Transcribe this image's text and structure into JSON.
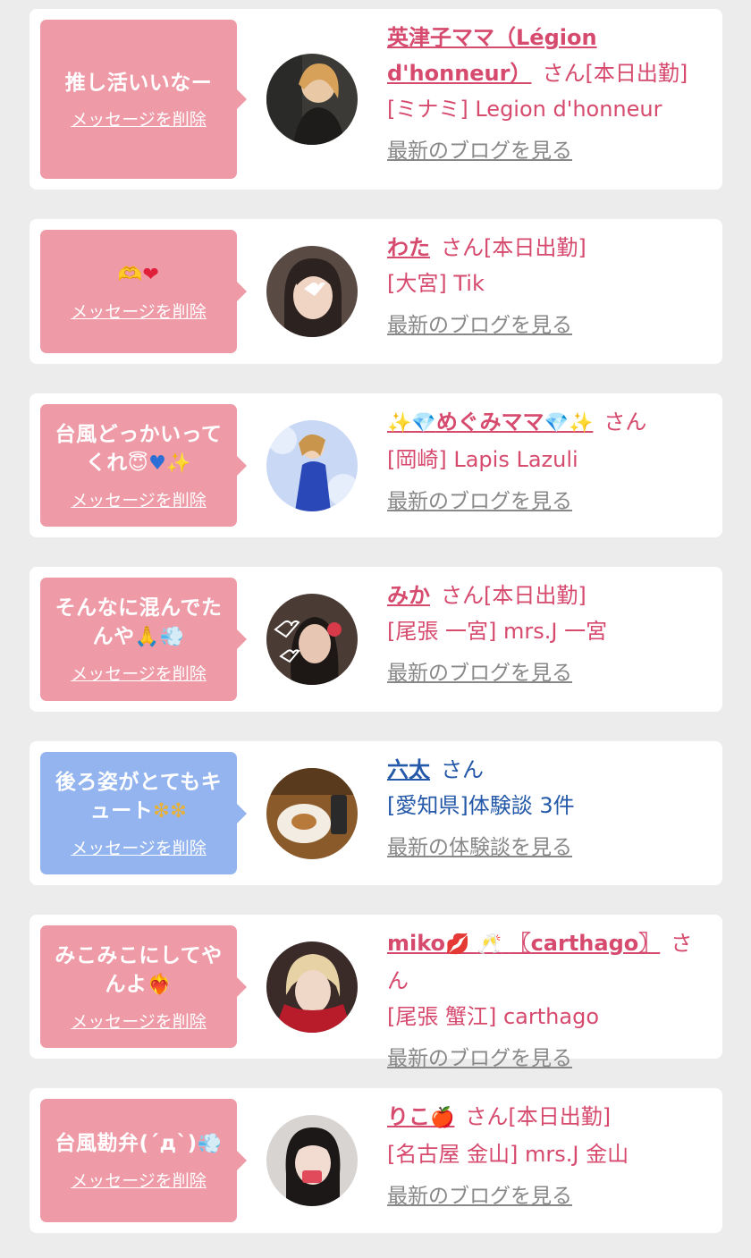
{
  "delete_label": "メッセージを削除",
  "colors": {
    "pink_bubble": "#ee9aa7",
    "blue_bubble": "#93b4ee",
    "pink_text": "#d64a6e",
    "blue_text": "#2458a8",
    "link_gray": "#888888"
  },
  "messages": [
    {
      "message_lines": [
        "推し活いいなー"
      ],
      "name": "英津子ママ（Légion d'honneur）",
      "suffix": "さん[本日出勤]",
      "shop": "[ミナミ] Legion d'honneur",
      "link": "最新のブログを見る"
    },
    {
      "message_lines": [
        ""
      ],
      "message_icons": [
        "hands-heart-icon",
        "red-heart-icon"
      ],
      "name": "わた",
      "suffix": "さん[本日出勤]",
      "shop": "[大宮] Tik",
      "link": "最新のブログを見る"
    },
    {
      "message_lines": [
        "台風どっかいって",
        "くれ"
      ],
      "message_icons": [
        "halo-smile-icon",
        "blue-heart-icon",
        "sparkles-icon"
      ],
      "name": "めぐみママ",
      "name_icons": [
        "sparkles-icon",
        "gem-icon",
        "gem-icon",
        "sparkles-icon"
      ],
      "suffix": "さん",
      "shop": "[岡崎] Lapis Lazuli",
      "link": "最新のブログを見る"
    },
    {
      "message_lines": [
        "そんなに混んでた",
        "んや"
      ],
      "message_icons": [
        "pray-icon",
        "swirl-icon"
      ],
      "name": "みか",
      "suffix": "さん[本日出勤]",
      "shop": "[尾張 一宮] mrs.J 一宮",
      "link": "最新のブログを見る"
    },
    {
      "message_lines": [
        "後ろ姿がとてもキ",
        "ュート"
      ],
      "message_icons": [
        "sparkle-icon",
        "sparkle-icon"
      ],
      "name": "六太",
      "suffix": "さん",
      "shop": "[愛知県]体験談 3件",
      "link": "最新の体験談を見る",
      "variant": "blue"
    },
    {
      "message_lines": [
        "みこみこにしてや",
        "んよ"
      ],
      "message_icons": [
        "heart-fire-icon"
      ],
      "name": "miko",
      "name_tail": "〖carthago〗",
      "name_icons": [
        "lips-icon",
        "champagne-icon"
      ],
      "suffix": "さん",
      "shop": "[尾張 蟹江] carthago",
      "link": "最新のブログを見る"
    },
    {
      "message_lines": [
        "台風勘弁(´д`)"
      ],
      "message_icons": [
        "swirl-icon"
      ],
      "name": "りこ",
      "name_icons": [
        "apple-icon"
      ],
      "suffix": "さん[本日出勤]",
      "shop": "[名古屋 金山] mrs.J 金山",
      "link": "最新のブログを見る"
    }
  ]
}
